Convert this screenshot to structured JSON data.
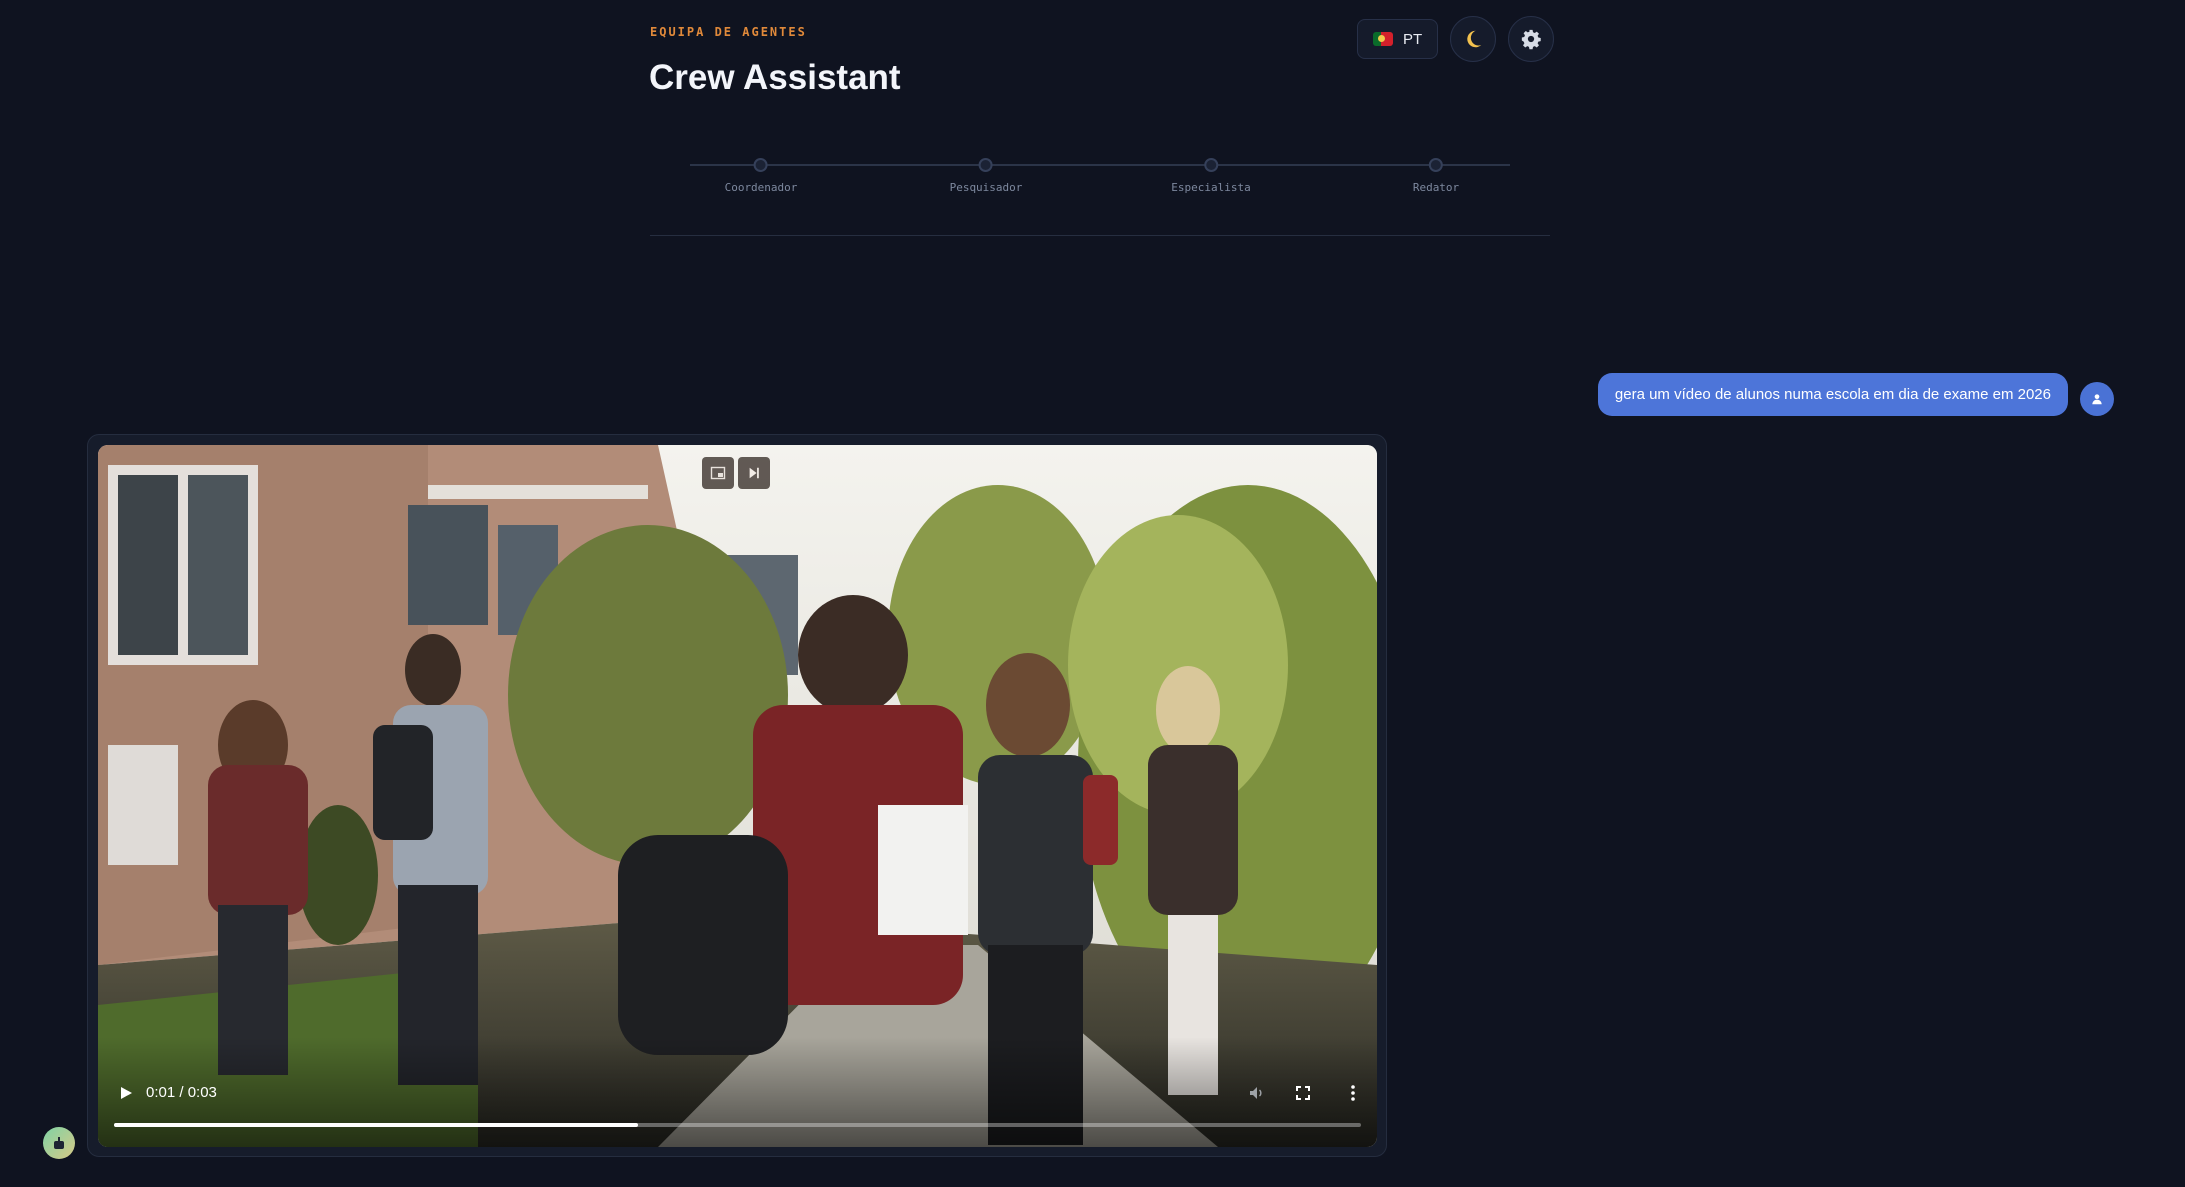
{
  "header": {
    "eyebrow": "EQUIPA DE AGENTES",
    "title": "Crew Assistant",
    "language_label": "PT",
    "theme_icon": "moon-icon",
    "settings_icon": "gear-icon"
  },
  "agents": [
    {
      "label": "Coordenador"
    },
    {
      "label": "Pesquisador"
    },
    {
      "label": "Especialista"
    },
    {
      "label": "Redator"
    }
  ],
  "chat": {
    "user_message": "gera um vídeo de alunos numa escola em dia de exame em 2026"
  },
  "video": {
    "time_display": "0:01 / 0:03",
    "progress_fraction": 0.42,
    "description_icon": "video-frame-students"
  },
  "colors": {
    "background": "#0f1320",
    "accent_orange": "#e0893a",
    "user_bubble": "#4d75d9"
  }
}
